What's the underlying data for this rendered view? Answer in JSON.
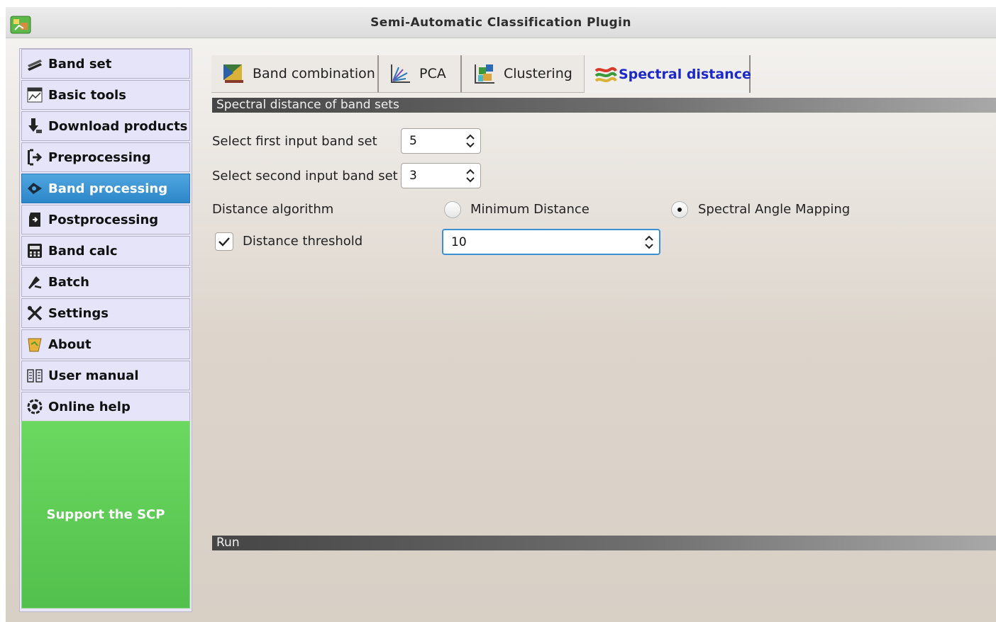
{
  "window": {
    "title": "Semi-Automatic Classification Plugin"
  },
  "sidebar": {
    "items": [
      {
        "label": "Band set",
        "icon": "band-set-icon"
      },
      {
        "label": "Basic tools",
        "icon": "basic-tools-icon"
      },
      {
        "label": "Download products",
        "icon": "download-icon"
      },
      {
        "label": "Preprocessing",
        "icon": "preprocessing-icon"
      },
      {
        "label": "Band processing",
        "icon": "band-processing-icon",
        "selected": true
      },
      {
        "label": "Postprocessing",
        "icon": "postprocessing-icon"
      },
      {
        "label": "Band calc",
        "icon": "band-calc-icon"
      },
      {
        "label": "Batch",
        "icon": "batch-icon"
      },
      {
        "label": "Settings",
        "icon": "settings-icon"
      },
      {
        "label": "About",
        "icon": "about-icon"
      },
      {
        "label": "User manual",
        "icon": "user-manual-icon"
      },
      {
        "label": "Online help",
        "icon": "online-help-icon"
      }
    ],
    "support_label": "Support the SCP"
  },
  "tabs": [
    {
      "label": "Band combination",
      "icon": "band-combination-icon"
    },
    {
      "label": "PCA",
      "icon": "pca-icon"
    },
    {
      "label": "Clustering",
      "icon": "clustering-icon"
    },
    {
      "label": "Spectral distance",
      "icon": "spectral-distance-icon",
      "active": true
    }
  ],
  "panel": {
    "section_title": "Spectral distance of band sets",
    "first_band_set": {
      "label": "Select first input band set",
      "value": "5"
    },
    "second_band_set": {
      "label": "Select second input band set",
      "value": "3"
    },
    "algorithm": {
      "label": "Distance algorithm",
      "options": [
        "Minimum Distance",
        "Spectral Angle Mapping"
      ],
      "selected": "Spectral Angle Mapping"
    },
    "threshold": {
      "label": "Distance threshold",
      "checked": true,
      "value": "10"
    },
    "run_section_title": "Run"
  },
  "colors": {
    "sidebar_bg": "#e9e7f7",
    "active_item": "#2d86c8",
    "support_bg": "#5ccb55",
    "active_tab_text": "#1c28c8",
    "focus_border": "#3d8fd0"
  }
}
